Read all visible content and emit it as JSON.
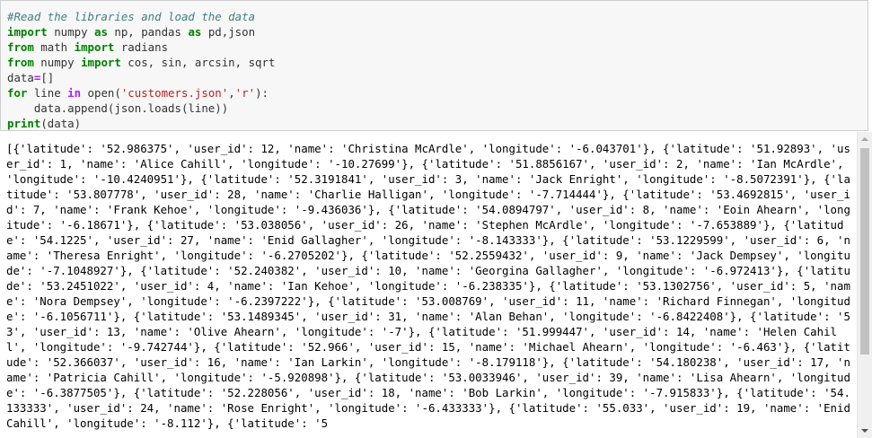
{
  "code_cell": {
    "lines": [
      [
        {
          "t": "#Read the libraries and load the data",
          "c": "comment"
        }
      ],
      [
        {
          "t": "import",
          "c": "kw"
        },
        {
          "t": " numpy ",
          "c": "plain"
        },
        {
          "t": "as",
          "c": "kw"
        },
        {
          "t": " np, pandas ",
          "c": "plain"
        },
        {
          "t": "as",
          "c": "kw"
        },
        {
          "t": " pd,json",
          "c": "plain"
        }
      ],
      [
        {
          "t": "from",
          "c": "kw"
        },
        {
          "t": " math ",
          "c": "plain"
        },
        {
          "t": "import",
          "c": "kw"
        },
        {
          "t": " radians",
          "c": "plain"
        }
      ],
      [
        {
          "t": "from",
          "c": "kw"
        },
        {
          "t": " numpy ",
          "c": "plain"
        },
        {
          "t": "import",
          "c": "kw"
        },
        {
          "t": " cos, sin, arcsin, sqrt",
          "c": "plain"
        }
      ],
      [
        {
          "t": "data",
          "c": "plain"
        },
        {
          "t": "=",
          "c": "op"
        },
        {
          "t": "[]",
          "c": "plain"
        }
      ],
      [
        {
          "t": "for",
          "c": "kw"
        },
        {
          "t": " line ",
          "c": "plain"
        },
        {
          "t": "in",
          "c": "op"
        },
        {
          "t": " open(",
          "c": "plain"
        },
        {
          "t": "'customers.json'",
          "c": "str"
        },
        {
          "t": ",",
          "c": "plain"
        },
        {
          "t": "'r'",
          "c": "str"
        },
        {
          "t": "):",
          "c": "plain"
        }
      ],
      [
        {
          "t": "    data.append(json.loads(line))",
          "c": "plain"
        }
      ],
      [
        {
          "t": "print",
          "c": "kw"
        },
        {
          "t": "(data)",
          "c": "plain"
        }
      ]
    ]
  },
  "output": {
    "text": "[{'latitude': '52.986375', 'user_id': 12, 'name': 'Christina McArdle', 'longitude': '-6.043701'}, {'latitude': '51.92893', 'user_id': 1, 'name': 'Alice Cahill', 'longitude': '-10.27699'}, {'latitude': '51.8856167', 'user_id': 2, 'name': 'Ian McArdle', 'longitude': '-10.4240951'}, {'latitude': '52.3191841', 'user_id': 3, 'name': 'Jack Enright', 'longitude': '-8.5072391'}, {'latitude': '53.807778', 'user_id': 28, 'name': 'Charlie Halligan', 'longitude': '-7.714444'}, {'latitude': '53.4692815', 'user_id': 7, 'name': 'Frank Kehoe', 'longitude': '-9.436036'}, {'latitude': '54.0894797', 'user_id': 8, 'name': 'Eoin Ahearn', 'longitude': '-6.18671'}, {'latitude': '53.038056', 'user_id': 26, 'name': 'Stephen McArdle', 'longitude': '-7.653889'}, {'latitude': '54.1225', 'user_id': 27, 'name': 'Enid Gallagher', 'longitude': '-8.143333'}, {'latitude': '53.1229599', 'user_id': 6, 'name': 'Theresa Enright', 'longitude': '-6.2705202'}, {'latitude': '52.2559432', 'user_id': 9, 'name': 'Jack Dempsey', 'longitude': '-7.1048927'}, {'latitude': '52.240382', 'user_id': 10, 'name': 'Georgina Gallagher', 'longitude': '-6.972413'}, {'latitude': '53.2451022', 'user_id': 4, 'name': 'Ian Kehoe', 'longitude': '-6.238335'}, {'latitude': '53.1302756', 'user_id': 5, 'name': 'Nora Dempsey', 'longitude': '-6.2397222'}, {'latitude': '53.008769', 'user_id': 11, 'name': 'Richard Finnegan', 'longitude': '-6.1056711'}, {'latitude': '53.1489345', 'user_id': 31, 'name': 'Alan Behan', 'longitude': '-6.8422408'}, {'latitude': '53', 'user_id': 13, 'name': 'Olive Ahearn', 'longitude': '-7'}, {'latitude': '51.999447', 'user_id': 14, 'name': 'Helen Cahill', 'longitude': '-9.742744'}, {'latitude': '52.966', 'user_id': 15, 'name': 'Michael Ahearn', 'longitude': '-6.463'}, {'latitude': '52.366037', 'user_id': 16, 'name': 'Ian Larkin', 'longitude': '-8.179118'}, {'latitude': '54.180238', 'user_id': 17, 'name': 'Patricia Cahill', 'longitude': '-5.920898'}, {'latitude': '53.0033946', 'user_id': 39, 'name': 'Lisa Ahearn', 'longitude': '-6.3877505'}, {'latitude': '52.228056', 'user_id': 18, 'name': 'Bob Larkin', 'longitude': '-7.915833'}, {'latitude': '54.133333', 'user_id': 24, 'name': 'Rose Enright', 'longitude': '-6.433333'}, {'latitude': '55.033', 'user_id': 19, 'name': 'Enid Cahill', 'longitude': '-8.112'}, {'latitude': '5"
  }
}
